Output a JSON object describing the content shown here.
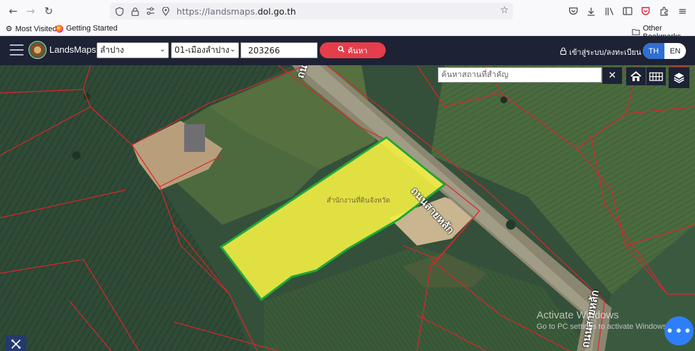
{
  "browser": {
    "url_prefix": "https://landsmaps.",
    "url_domain": "dol.go.th",
    "bookmarks": {
      "most_visited": "Most Visited",
      "getting_started": "Getting Started",
      "other": "Other Bookmarks"
    },
    "icons": [
      "back-icon",
      "forward-icon",
      "reload-icon",
      "shield-icon",
      "lock-icon",
      "permissions-icon",
      "location-icon",
      "star-icon",
      "pocket-icon",
      "download-icon",
      "library-icon",
      "sidebar-icon",
      "extension-icon",
      "menu-icon"
    ]
  },
  "app": {
    "title": "LandsMaps",
    "province_select": "ลำปาง",
    "district_select": "01-เมืองลำปาง",
    "parcel_number": "203266",
    "search_label": "ค้นหา",
    "login_label": "เข้าสู่ระบบ/ลงทะเบียน",
    "lang_th": "TH",
    "lang_en": "EN"
  },
  "map": {
    "place_search_placeholder": "ค้นหาสถานที่สำคัญ",
    "road_label_1": "ถนนสายหลัก",
    "road_label_2": "ถนนสายหลัก",
    "road_label_3": "ถนนสายหลัก",
    "parcel_label": "สำนักงานที่ดินจังหวัด",
    "parcel_highlight_color": "#f4ef45",
    "parcel_border_color": "#1fa83a",
    "boundary_color": "#e0242b",
    "controls": [
      "home-icon",
      "grid-icon",
      "layers-icon",
      "measure-icon",
      "more-icon"
    ]
  },
  "os_watermark": {
    "line1": "Activate Windows",
    "line2": "Go to PC settings to activate Windows."
  }
}
